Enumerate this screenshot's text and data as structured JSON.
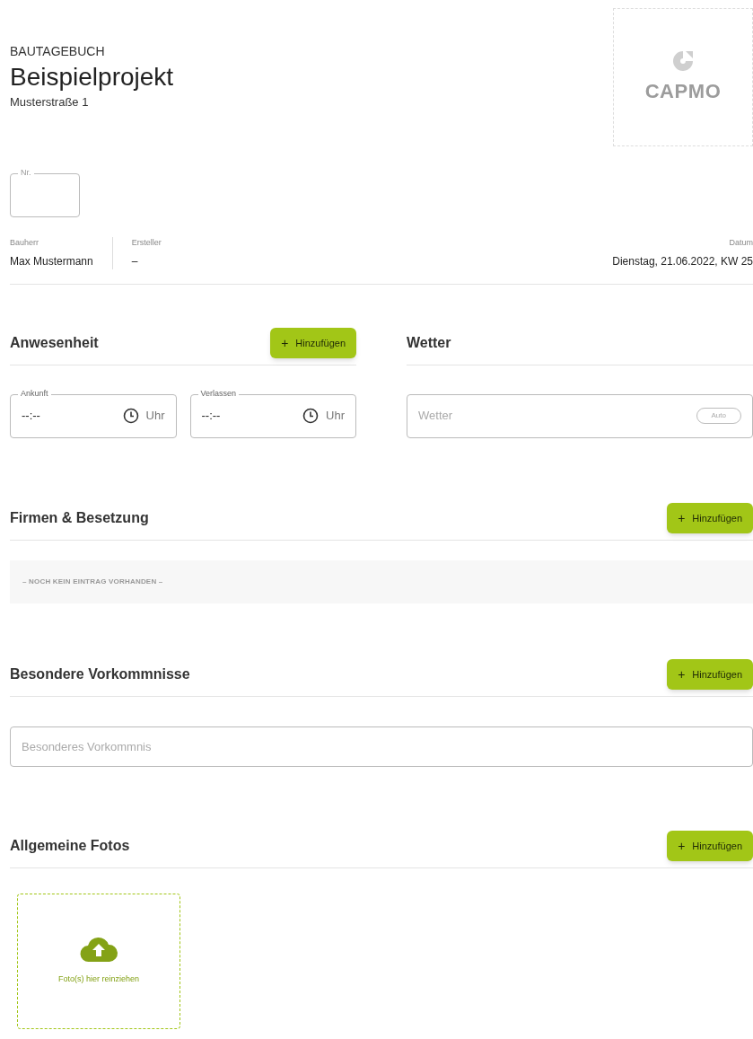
{
  "header": {
    "overline": "BAUTAGEBUCH",
    "title": "Beispielprojekt",
    "address": "Musterstraße 1",
    "logo_text": "CAPMO"
  },
  "number_field": {
    "label": "Nr."
  },
  "meta": [
    {
      "label": "Bauherr",
      "value": "Max Mustermann"
    },
    {
      "label": "Ersteller",
      "value": "–"
    }
  ],
  "date": {
    "label": "Datum",
    "value": "Dienstag, 21.06.2022, KW 25"
  },
  "attendance": {
    "title": "Anwesenheit",
    "button": "Hinzufügen",
    "button_icon": "+",
    "fields": [
      {
        "label": "Ankunft",
        "value": "--:--",
        "unit": "Uhr"
      },
      {
        "label": "Verlassen",
        "value": "--:--",
        "unit": "Uhr"
      }
    ]
  },
  "weather": {
    "title": "Wetter",
    "placeholder": "Wetter",
    "toggle": "Auto"
  },
  "sections": [
    {
      "kind": "empty",
      "title": "Firmen & Besetzung",
      "button": "Hinzufügen",
      "button_icon": "+",
      "empty_text": "– NOCH KEIN EINTRAG VORHANDEN –"
    },
    {
      "kind": "input",
      "title": "Besondere Vorkommnisse",
      "button": "Hinzufügen",
      "button_icon": "+",
      "placeholder": "Besonderes Vorkommnis"
    },
    {
      "kind": "upload",
      "title": "Allgemeine Fotos",
      "button": "Hinzufügen",
      "button_icon": "+",
      "drop_text": "Foto(s) hier reinziehen"
    }
  ]
}
